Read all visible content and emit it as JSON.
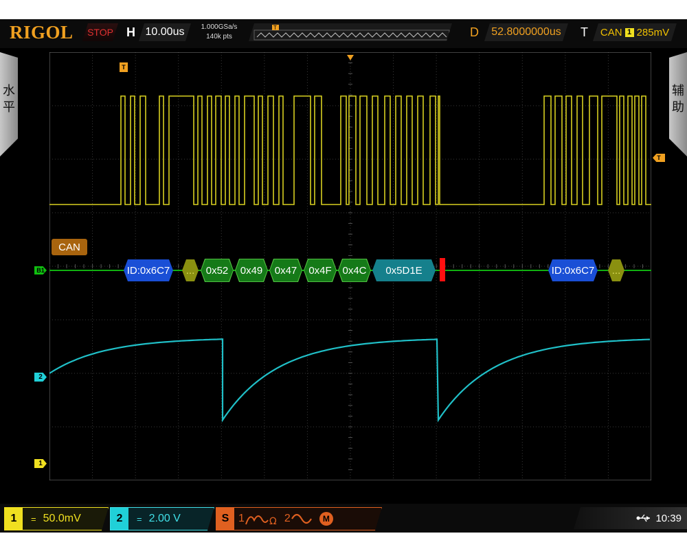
{
  "brand": "RIGOL",
  "top": {
    "run_state": "STOP",
    "horizontal_label": "H",
    "timebase": "10.00us",
    "sample_rate": "1.000GSa/s",
    "memory_depth": "140k pts",
    "delay_label": "D",
    "delay": "52.8000000us",
    "trigger_label": "T",
    "trigger_type": "CAN",
    "trigger_source": "1",
    "trigger_level": "285mV"
  },
  "side": {
    "left_tab": [
      "水",
      "平"
    ],
    "right_tab": [
      "辅",
      "助"
    ]
  },
  "markers": {
    "trigger_position": "T",
    "trigger_level": "T",
    "bus": "B1",
    "ch2": "2",
    "ch1": "1"
  },
  "decode": {
    "bus_name": "CAN",
    "frames": [
      {
        "label": "ID:0x6C7",
        "kind": "id"
      },
      {
        "label": "...",
        "kind": "dots"
      },
      {
        "label": "0x52",
        "kind": "data"
      },
      {
        "label": "0x49",
        "kind": "data"
      },
      {
        "label": "0x47",
        "kind": "data"
      },
      {
        "label": "0x4F",
        "kind": "data"
      },
      {
        "label": "0x4C",
        "kind": "data"
      },
      {
        "label": "0x5D1E",
        "kind": "crc"
      },
      {
        "label": "ID:0x6C7",
        "kind": "id"
      },
      {
        "label": "...",
        "kind": "dots"
      }
    ]
  },
  "bottom": {
    "ch1": {
      "number": "1",
      "coupling": "=",
      "scale": "50.0mV"
    },
    "ch2": {
      "number": "2",
      "coupling": "=",
      "scale": "2.00 V"
    },
    "math": {
      "label": "S",
      "src1": "1",
      "src2": "2",
      "icon": "M"
    },
    "time": "10:39"
  },
  "colors": {
    "ch1": "#f0e020",
    "ch2": "#20d0d8",
    "accent": "#f0a020",
    "bus": "#10b010"
  }
}
